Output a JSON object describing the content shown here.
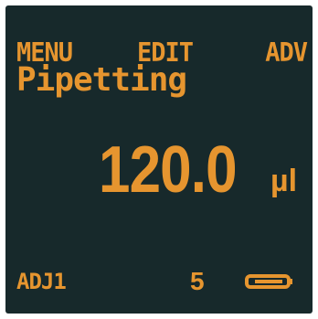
{
  "softkeys": {
    "left": "MENU",
    "center": "EDIT",
    "right": "ADV"
  },
  "mode": {
    "title": "Pipetting"
  },
  "volume": {
    "value": "120.0",
    "unit": "µl"
  },
  "status": {
    "adjustment": "ADJ1",
    "count": "5",
    "battery_icon": "battery-icon"
  },
  "colors": {
    "display_background": "#17292b",
    "text": "#e6952f"
  }
}
